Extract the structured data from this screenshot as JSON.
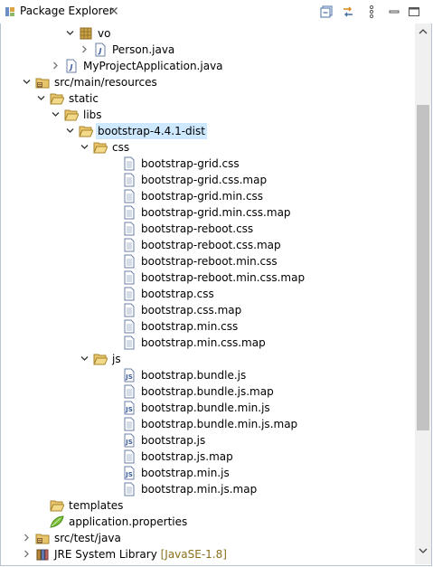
{
  "view": {
    "title": "Package Explorer",
    "toolbar": [
      "collapse-all-icon",
      "link-with-editor-icon",
      "view-menu-icon",
      "minimize-icon",
      "maximize-icon"
    ]
  },
  "tree": [
    {
      "label": "vo",
      "icon": "package-icon",
      "expanded": true,
      "level": 4
    },
    {
      "label": "Person.java",
      "icon": "java-file-icon",
      "expanded": false,
      "level": 5
    },
    {
      "label": "MyProjectApplication.java",
      "icon": "java-file-icon",
      "expanded": false,
      "level": 3
    },
    {
      "label": "src/main/resources",
      "icon": "source-folder-icon",
      "expanded": true,
      "level": 1
    },
    {
      "label": "static",
      "icon": "folder-open-icon",
      "expanded": true,
      "level": 2
    },
    {
      "label": "libs",
      "icon": "folder-open-icon",
      "expanded": true,
      "level": 3
    },
    {
      "label": "bootstrap-4.4.1-dist",
      "icon": "folder-open-icon",
      "expanded": true,
      "level": 4,
      "selected": true
    },
    {
      "label": "css",
      "icon": "folder-open-icon",
      "expanded": true,
      "level": 5
    },
    {
      "label": "bootstrap-grid.css",
      "icon": "text-file-icon",
      "level": 7
    },
    {
      "label": "bootstrap-grid.css.map",
      "icon": "text-file-icon",
      "level": 7
    },
    {
      "label": "bootstrap-grid.min.css",
      "icon": "text-file-icon",
      "level": 7
    },
    {
      "label": "bootstrap-grid.min.css.map",
      "icon": "text-file-icon",
      "level": 7
    },
    {
      "label": "bootstrap-reboot.css",
      "icon": "text-file-icon",
      "level": 7
    },
    {
      "label": "bootstrap-reboot.css.map",
      "icon": "text-file-icon",
      "level": 7
    },
    {
      "label": "bootstrap-reboot.min.css",
      "icon": "text-file-icon",
      "level": 7
    },
    {
      "label": "bootstrap-reboot.min.css.map",
      "icon": "text-file-icon",
      "level": 7
    },
    {
      "label": "bootstrap.css",
      "icon": "text-file-icon",
      "level": 7
    },
    {
      "label": "bootstrap.css.map",
      "icon": "text-file-icon",
      "level": 7
    },
    {
      "label": "bootstrap.min.css",
      "icon": "text-file-icon",
      "level": 7
    },
    {
      "label": "bootstrap.min.css.map",
      "icon": "text-file-icon",
      "level": 7
    },
    {
      "label": "js",
      "icon": "folder-open-icon",
      "expanded": true,
      "level": 5
    },
    {
      "label": "bootstrap.bundle.js",
      "icon": "js-file-icon",
      "level": 7
    },
    {
      "label": "bootstrap.bundle.js.map",
      "icon": "text-file-icon",
      "level": 7
    },
    {
      "label": "bootstrap.bundle.min.js",
      "icon": "js-file-icon",
      "level": 7
    },
    {
      "label": "bootstrap.bundle.min.js.map",
      "icon": "text-file-icon",
      "level": 7
    },
    {
      "label": "bootstrap.js",
      "icon": "js-file-icon",
      "level": 7
    },
    {
      "label": "bootstrap.js.map",
      "icon": "text-file-icon",
      "level": 7
    },
    {
      "label": "bootstrap.min.js",
      "icon": "js-file-icon",
      "level": 7
    },
    {
      "label": "bootstrap.min.js.map",
      "icon": "text-file-icon",
      "level": 7
    },
    {
      "label": "templates",
      "icon": "folder-open-icon",
      "level": 2
    },
    {
      "label": "application.properties",
      "icon": "properties-file-icon",
      "level": 2
    },
    {
      "label": "src/test/java",
      "icon": "source-folder-icon",
      "expanded": false,
      "level": 1
    },
    {
      "label": "JRE System Library",
      "decoration": "[JavaSE-1.8]",
      "icon": "library-icon",
      "expanded": false,
      "level": 1
    }
  ],
  "colors": {
    "selection": "#cde8ff",
    "folder": "#e8c46a",
    "border": "#b9c4d2"
  }
}
